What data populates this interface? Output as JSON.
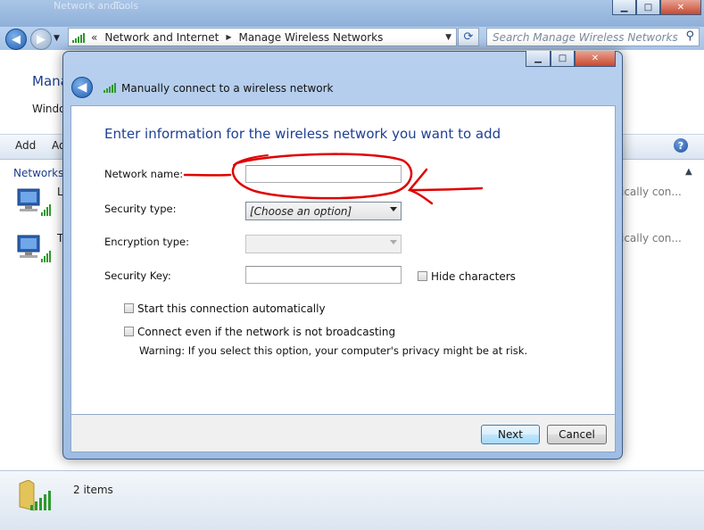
{
  "window": {
    "tabs": [
      "Network and...",
      "Tools"
    ],
    "minimize": "▁",
    "maximize": "□",
    "close": "✕"
  },
  "navbar": {
    "breadcrumb_sep": "«",
    "crumb1": "Network and Internet",
    "crumb_arrow": "▶",
    "crumb2": "Manage Wireless Networks",
    "search_placeholder": "Search Manage Wireless Networks"
  },
  "background": {
    "header_title": "Mana",
    "header_sub": "Windo",
    "toolbar_add": "Add",
    "toolbar_adapter": "Ad",
    "networks_label": "Networks y",
    "rows": [
      {
        "name": "L",
        "status": "ically con..."
      },
      {
        "name": "T",
        "status": "ically con..."
      }
    ],
    "status_items": "2 items"
  },
  "dialog": {
    "title": "Manually connect to a wireless network",
    "heading": "Enter information for the wireless network you want to add",
    "network_name_label": "Network name:",
    "network_name_value": "",
    "security_type_label": "Security type:",
    "security_type_value": "[Choose an option]",
    "encryption_type_label": "Encryption type:",
    "encryption_type_value": "",
    "security_key_label": "Security Key:",
    "security_key_value": "",
    "hide_characters": "Hide characters",
    "start_auto": "Start this connection automatically",
    "connect_even": "Connect even if the network is not broadcasting",
    "warning": "Warning: If you select this option, your computer's privacy might be at risk.",
    "next": "Next",
    "cancel": "Cancel"
  },
  "colors": {
    "annotation": "#e00000",
    "heading": "#1e3f94"
  }
}
